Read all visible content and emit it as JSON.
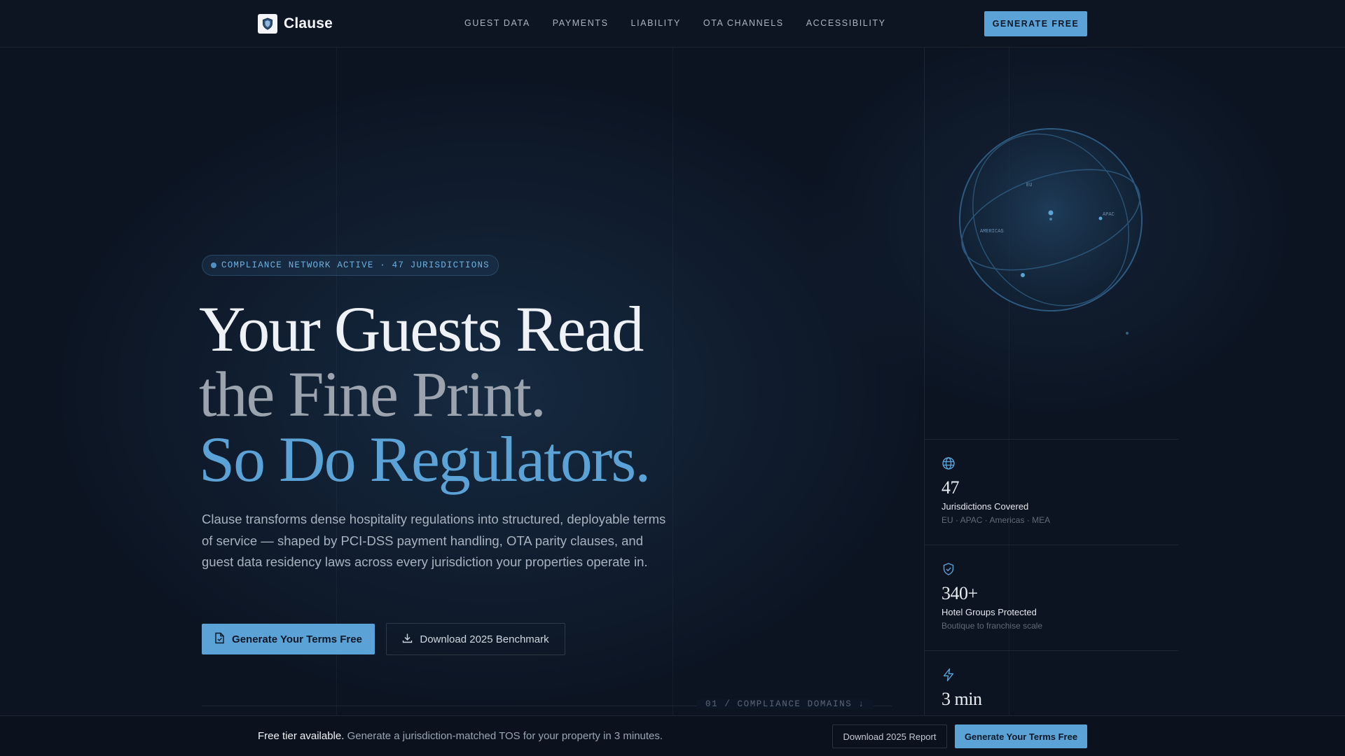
{
  "brand": {
    "name": "Clause",
    "logo_icon": "shield-icon"
  },
  "nav": {
    "links": [
      "GUEST DATA",
      "PAYMENTS",
      "LIABILITY",
      "OTA CHANNELS",
      "ACCESSIBILITY"
    ],
    "cta_label": "GENERATE FREE"
  },
  "hero": {
    "badge": "COMPLIANCE NETWORK ACTIVE · 47 JURISDICTIONS",
    "headline": {
      "line1": "Your Guests Read",
      "line2": "the Fine Print.",
      "line3": "So Do Regulators."
    },
    "lede": "Clause transforms dense hospitality regulations into structured, deployable terms of service — shaped by PCI-DSS payment handling, OTA parity clauses, and guest data residency laws across every jurisdiction your properties operate in.",
    "primary_cta": {
      "label": "Generate Your Terms Free",
      "icon": "document-icon"
    },
    "secondary_cta": {
      "label": "Download 2025 Benchmark",
      "icon": "download-icon"
    },
    "section_label": "01 / COMPLIANCE DOMAINS ↓"
  },
  "globe": {
    "labels": {
      "eu": "EU",
      "apac": "APAC",
      "americas": "AMERICAS"
    }
  },
  "stats": [
    {
      "icon": "globe-icon",
      "value": "47",
      "label": "Jurisdictions Covered",
      "sub": "EU · APAC · Americas · MEA"
    },
    {
      "icon": "shield-check-icon",
      "value": "340+",
      "label": "Hotel Groups Protected",
      "sub": "Boutique to franchise scale"
    },
    {
      "icon": "lightning-icon",
      "value": "3 min",
      "label": "",
      "sub": ""
    }
  ],
  "footer_bar": {
    "strong": "Free tier available.",
    "text": " Generate a jurisdiction-matched TOS for your property in 3 minutes.",
    "outline_button": "Download 2025 Report",
    "button": "Generate Your Terms Free"
  },
  "colors": {
    "accent": "#5ba3d6",
    "background": "#0c1422",
    "muted_heading": "#9aa3ae"
  }
}
